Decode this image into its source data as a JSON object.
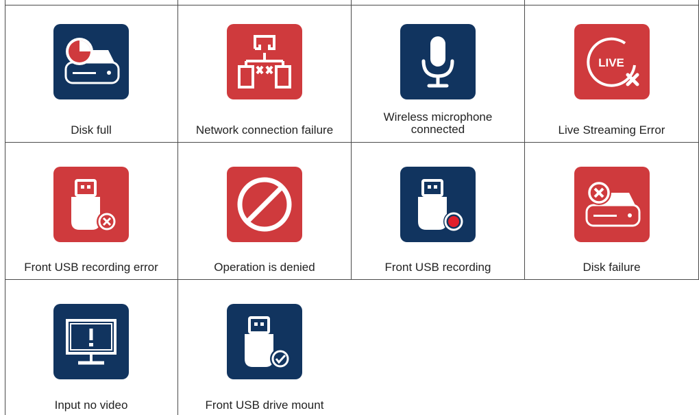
{
  "colors": {
    "red_tile": "#cf3a3d",
    "blue_tile": "#11345f",
    "grid_line": "#4a4a4a"
  },
  "rows": [
    [
      {
        "label": "Disk full",
        "icon": "disk-full-icon",
        "color": "blue"
      },
      {
        "label": "Network connection failure",
        "icon": "network-failure-icon",
        "color": "red"
      },
      {
        "label": "Wireless microphone connected",
        "icon": "microphone-icon",
        "color": "blue"
      },
      {
        "label": "Live Streaming Error",
        "icon": "live-error-icon",
        "color": "red"
      }
    ],
    [
      {
        "label": "Front USB recording error",
        "icon": "usb-error-icon",
        "color": "red"
      },
      {
        "label": "Operation is denied",
        "icon": "denied-icon",
        "color": "red"
      },
      {
        "label": "Front USB recording",
        "icon": "usb-recording-icon",
        "color": "blue"
      },
      {
        "label": "Disk failure",
        "icon": "disk-failure-icon",
        "color": "red"
      }
    ],
    [
      {
        "label": "Input no video",
        "icon": "no-video-icon",
        "color": "blue"
      },
      {
        "label": "Front USB drive mount",
        "icon": "usb-mount-icon",
        "color": "blue"
      }
    ]
  ],
  "icon_texts": {
    "live": "LIVE"
  }
}
